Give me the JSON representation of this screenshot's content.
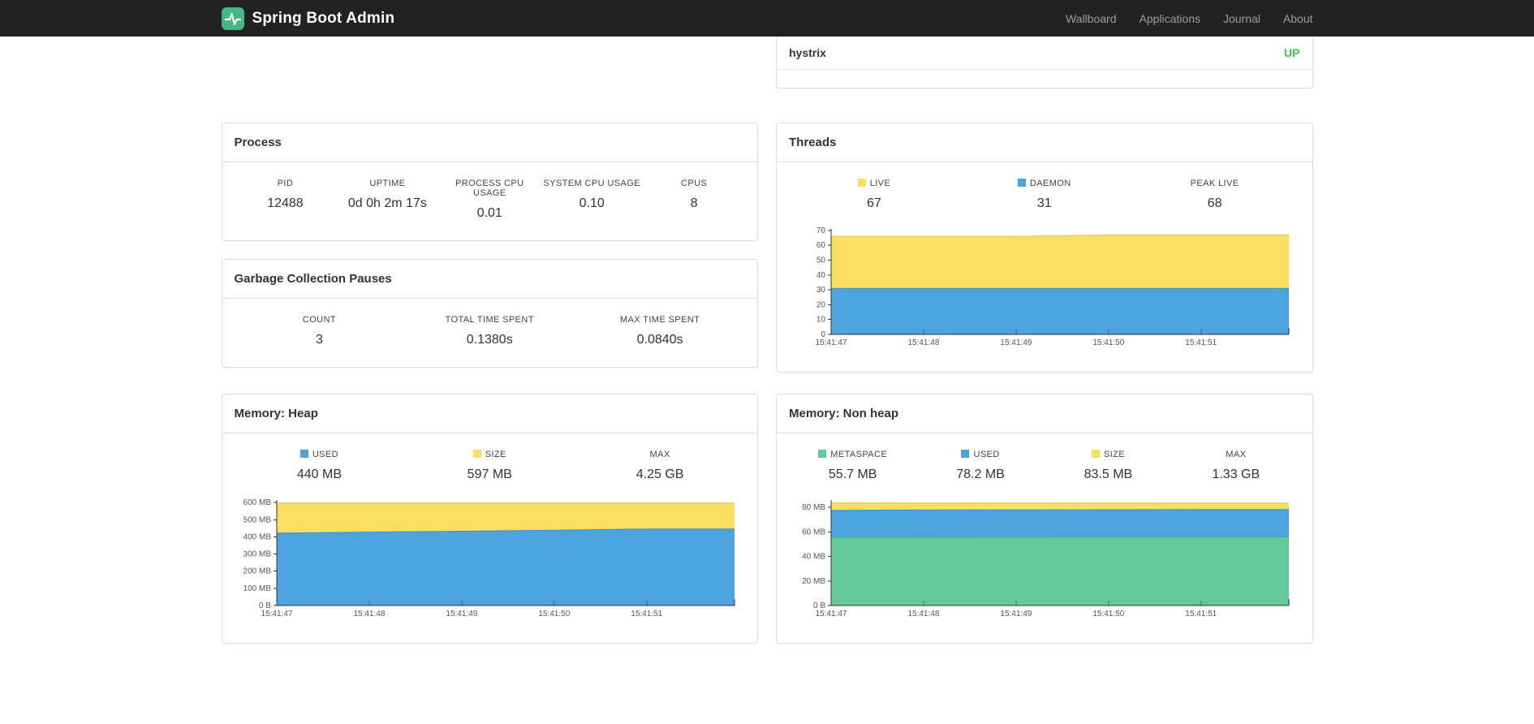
{
  "navbar": {
    "brand": "Spring Boot Admin",
    "links": [
      {
        "label": "Wallboard"
      },
      {
        "label": "Applications"
      },
      {
        "label": "Journal"
      },
      {
        "label": "About"
      }
    ]
  },
  "colors": {
    "accent_green": "#42b983",
    "status_up": "#44c044",
    "series_blue": "#4da3dd",
    "series_yellow": "#fadf63",
    "series_green": "#63c99b"
  },
  "application_status": {
    "name": "hystrix",
    "status": "UP",
    "status_color": "#44c044"
  },
  "process": {
    "title": "Process",
    "metrics": [
      {
        "label": "PID",
        "value": "12488"
      },
      {
        "label": "UPTIME",
        "value": "0d 0h 2m 17s"
      },
      {
        "label": "PROCESS CPU USAGE",
        "value": "0.01"
      },
      {
        "label": "SYSTEM CPU USAGE",
        "value": "0.10"
      },
      {
        "label": "CPUS",
        "value": "8"
      }
    ]
  },
  "gc": {
    "title": "Garbage Collection Pauses",
    "metrics": [
      {
        "label": "COUNT",
        "value": "3"
      },
      {
        "label": "TOTAL TIME SPENT",
        "value": "0.1380s"
      },
      {
        "label": "MAX TIME SPENT",
        "value": "0.0840s"
      }
    ]
  },
  "threads": {
    "title": "Threads",
    "metrics": [
      {
        "label": "LIVE",
        "value": "67",
        "color": "#fadf63"
      },
      {
        "label": "DAEMON",
        "value": "31",
        "color": "#4da3dd"
      },
      {
        "label": "PEAK LIVE",
        "value": "68"
      }
    ]
  },
  "heap": {
    "title": "Memory: Heap",
    "metrics": [
      {
        "label": "USED",
        "value": "440 MB",
        "color": "#4da3dd"
      },
      {
        "label": "SIZE",
        "value": "597 MB",
        "color": "#fadf63"
      },
      {
        "label": "MAX",
        "value": "4.25 GB"
      }
    ]
  },
  "nonheap": {
    "title": "Memory: Non heap",
    "metrics": [
      {
        "label": "METASPACE",
        "value": "55.7 MB",
        "color": "#63c99b"
      },
      {
        "label": "USED",
        "value": "78.2 MB",
        "color": "#4da3dd"
      },
      {
        "label": "SIZE",
        "value": "83.5 MB",
        "color": "#fadf63"
      },
      {
        "label": "MAX",
        "value": "1.33 GB"
      }
    ]
  },
  "chart_data": [
    {
      "id": "threads",
      "type": "area",
      "title": "Threads",
      "x": [
        "15:41:47",
        "15:41:48",
        "15:41:49",
        "15:41:50",
        "15:41:51"
      ],
      "series": [
        {
          "name": "LIVE",
          "color": "#fadf63",
          "edge": "#e7c54f",
          "values": [
            66,
            66,
            66,
            67,
            67
          ]
        },
        {
          "name": "DAEMON",
          "color": "#4da3dd",
          "edge": "#3c92cc",
          "values": [
            31,
            31,
            31,
            31,
            31
          ]
        }
      ],
      "ylim": [
        0,
        71
      ],
      "yticks": [
        {
          "v": 0,
          "label": "0"
        },
        {
          "v": 10,
          "label": "10"
        },
        {
          "v": 20,
          "label": "20"
        },
        {
          "v": 30,
          "label": "30"
        },
        {
          "v": 40,
          "label": "40"
        },
        {
          "v": 50,
          "label": "50"
        },
        {
          "v": 60,
          "label": "60"
        },
        {
          "v": 70,
          "label": "70"
        }
      ],
      "legend_position": "top",
      "grid": false
    },
    {
      "id": "heap",
      "type": "area",
      "title": "Memory: Heap",
      "x": [
        "15:41:47",
        "15:41:48",
        "15:41:49",
        "15:41:50",
        "15:41:51"
      ],
      "series": [
        {
          "name": "SIZE",
          "color": "#fadf63",
          "edge": "#e7c54f",
          "values": [
            597,
            597,
            597,
            597,
            597
          ]
        },
        {
          "name": "USED",
          "color": "#4da3dd",
          "edge": "#3c92cc",
          "values": [
            422,
            428,
            433,
            439,
            446
          ]
        }
      ],
      "ylim": [
        0,
        615
      ],
      "yticks": [
        {
          "v": 0,
          "label": "0 B"
        },
        {
          "v": 100,
          "label": "100 MB"
        },
        {
          "v": 200,
          "label": "200 MB"
        },
        {
          "v": 300,
          "label": "300 MB"
        },
        {
          "v": 400,
          "label": "400 MB"
        },
        {
          "v": 500,
          "label": "500 MB"
        },
        {
          "v": 600,
          "label": "600 MB"
        }
      ],
      "legend_position": "top",
      "grid": false
    },
    {
      "id": "nonheap",
      "type": "area",
      "title": "Memory: Non heap",
      "x": [
        "15:41:47",
        "15:41:48",
        "15:41:49",
        "15:41:50",
        "15:41:51"
      ],
      "series": [
        {
          "name": "SIZE",
          "color": "#fadf63",
          "edge": "#e7c54f",
          "values": [
            83.5,
            83.5,
            83.5,
            83.5,
            83.5
          ]
        },
        {
          "name": "USED",
          "color": "#4da3dd",
          "edge": "#3c92cc",
          "values": [
            77.6,
            77.9,
            78.0,
            78.1,
            78.2
          ]
        },
        {
          "name": "METASPACE",
          "color": "#63c99b",
          "edge": "#4fb98d",
          "values": [
            55.4,
            55.5,
            55.6,
            55.7,
            55.7
          ]
        }
      ],
      "ylim": [
        0,
        86
      ],
      "yticks": [
        {
          "v": 0,
          "label": "0 B"
        },
        {
          "v": 20,
          "label": "20 MB"
        },
        {
          "v": 40,
          "label": "40 MB"
        },
        {
          "v": 60,
          "label": "60 MB"
        },
        {
          "v": 80,
          "label": "80 MB"
        }
      ],
      "legend_position": "top",
      "grid": false
    }
  ]
}
